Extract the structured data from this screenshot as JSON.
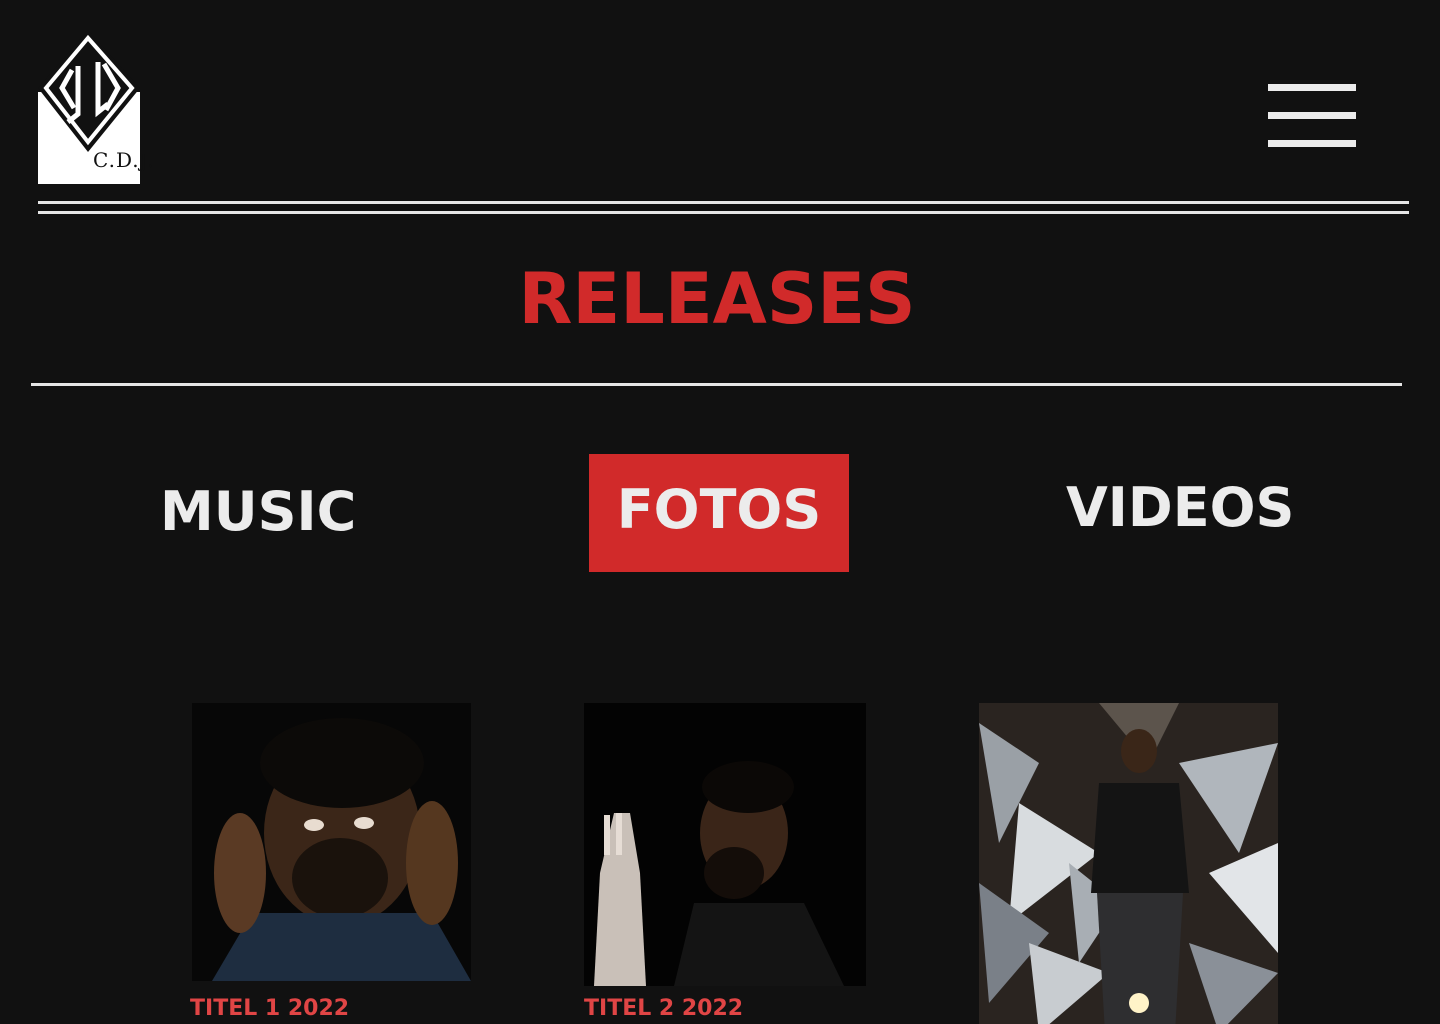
{
  "brand": {
    "logo_text": "C.D.J."
  },
  "header": {
    "menu_icon": "hamburger-icon"
  },
  "page": {
    "title": "RELEASES"
  },
  "tabs": [
    {
      "label": "MUSIC",
      "active": false
    },
    {
      "label": "FOTOS",
      "active": true
    },
    {
      "label": "VIDEOS",
      "active": false
    }
  ],
  "gallery": [
    {
      "caption": "TITEL 1 2022"
    },
    {
      "caption": "TITEL 2 2022"
    },
    {
      "caption": ""
    }
  ],
  "colors": {
    "background": "#111111",
    "accent": "#d12a2a",
    "text": "#ececec",
    "caption": "#e04545"
  }
}
